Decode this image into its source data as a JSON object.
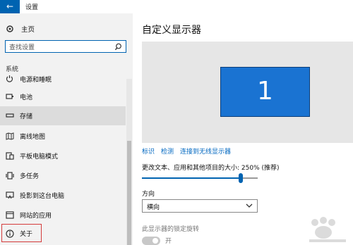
{
  "window": {
    "title": "设置",
    "back_glyph": "←"
  },
  "sidebar": {
    "home_label": "主页",
    "search_placeholder": "查找设置",
    "section_label": "系统",
    "items": [
      {
        "label": "电源和睡眠",
        "icon": "power-icon"
      },
      {
        "label": "电池",
        "icon": "battery-icon"
      },
      {
        "label": "存储",
        "icon": "storage-icon",
        "active": true
      },
      {
        "label": "离线地图",
        "icon": "map-icon"
      },
      {
        "label": "平板电脑模式",
        "icon": "tablet-icon"
      },
      {
        "label": "多任务",
        "icon": "multitask-icon"
      },
      {
        "label": "投影到这台电脑",
        "icon": "project-icon"
      },
      {
        "label": "网站的应用",
        "icon": "web-apps-icon"
      },
      {
        "label": "关于",
        "icon": "info-icon"
      }
    ]
  },
  "main": {
    "title": "自定义显示器",
    "monitor_number": "1",
    "links": {
      "identify": "标识",
      "detect": "检测",
      "wireless": "连接到无线显示器"
    },
    "scale_label": "更改文本、应用和其他项目的大小: 250% (推荐)",
    "scale_percent": 250,
    "orientation_label": "方向",
    "orientation_value": "横向",
    "rotation_lock_label": "此显示器的锁定旋转",
    "toggle_label": "开"
  },
  "colors": {
    "accent": "#0063b1",
    "monitor": "#1a73d2",
    "highlight_box": "#d43b3b"
  }
}
